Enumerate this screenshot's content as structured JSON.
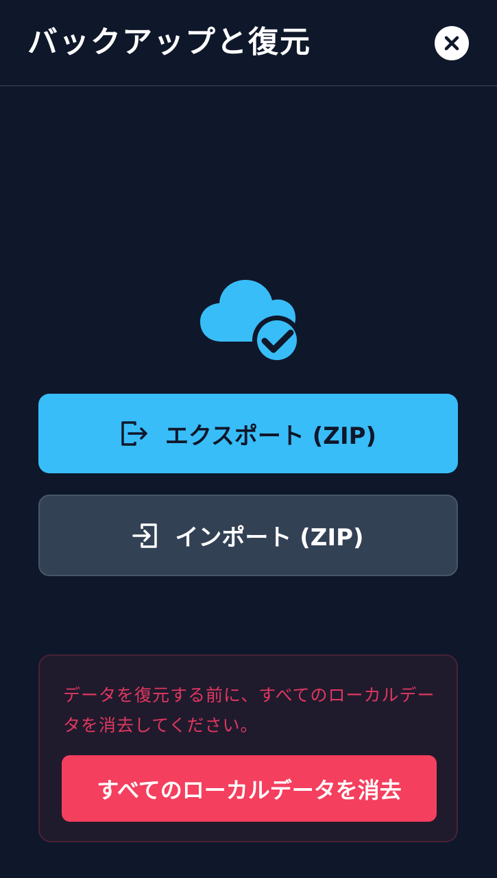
{
  "header": {
    "title": "バックアップと復元",
    "close_icon": "close-icon"
  },
  "status_icon": "cloud-done-icon",
  "colors": {
    "background": "#0f172a",
    "accent": "#38bdf8",
    "secondary_button": "#334155",
    "danger": "#f43f5e",
    "danger_text": "#e0385f",
    "danger_box_bg": "#201a2d"
  },
  "actions": {
    "export_label": "エクスポート (ZIP)",
    "export_icon": "export-icon",
    "import_label": "インポート (ZIP)",
    "import_icon": "import-icon"
  },
  "danger_zone": {
    "warning_text": "データを復元する前に、すべてのローカルデータを消去してください。",
    "clear_label": "すべてのローカルデータを消去"
  }
}
